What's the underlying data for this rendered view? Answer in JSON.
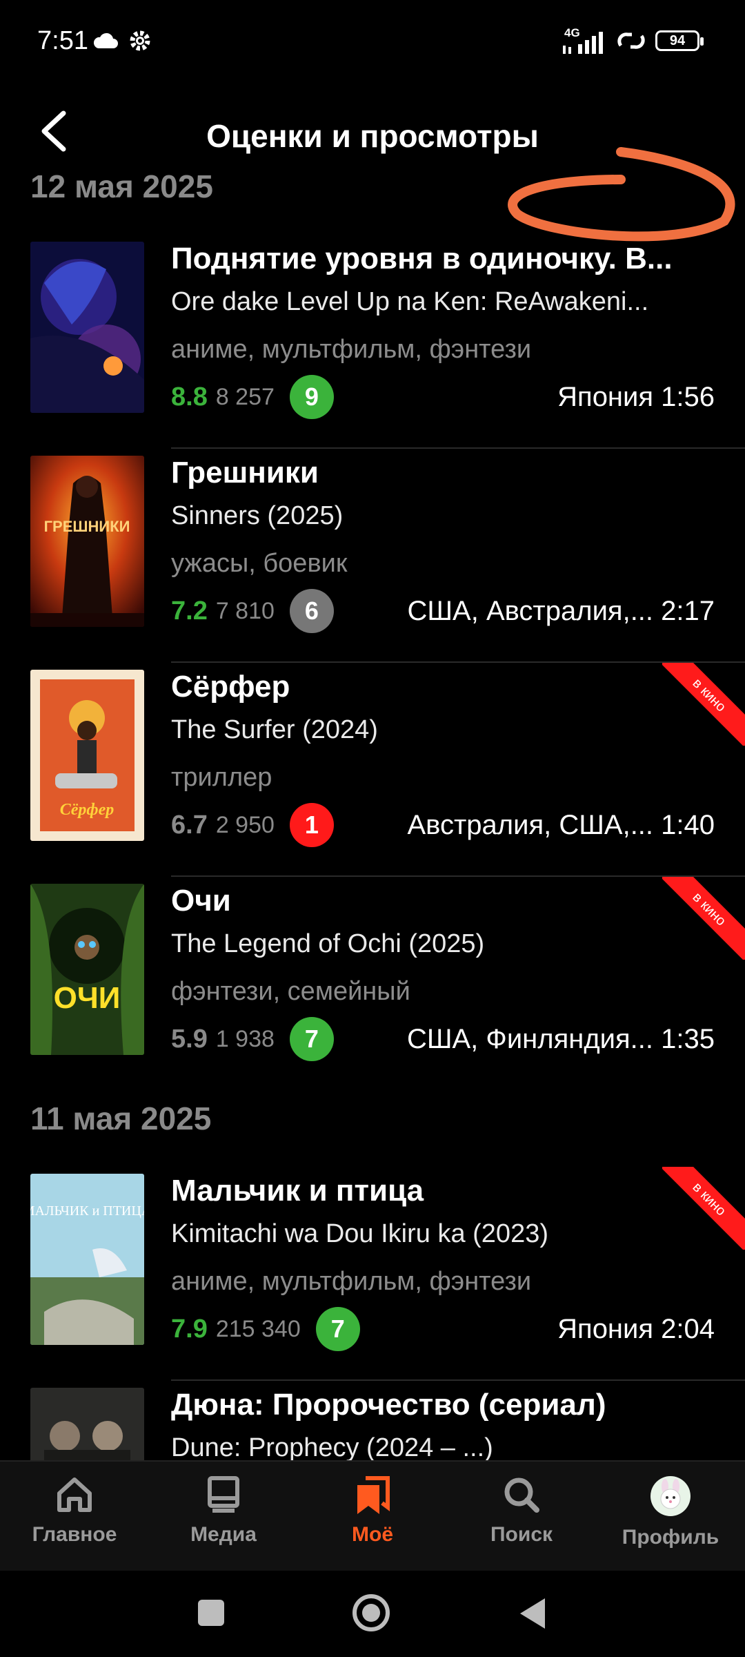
{
  "status_bar": {
    "time": "7:51",
    "network": "4G",
    "battery": "94"
  },
  "header": {
    "title": "Оценки и просмотры"
  },
  "sections": [
    {
      "date": "12 мая 2025",
      "items": [
        {
          "title": "Поднятие уровня в одиночку. В...",
          "original": "Ore dake Level Up na Ken: ReAwakeni...",
          "genres": "аниме, мультфильм, фэнтези",
          "rating": "8.8",
          "rating_color": "#3bb33b",
          "votes": "8 257",
          "user_score": "9",
          "user_score_color": "#3bb33b",
          "country_time": "Япония 1:56",
          "in_cinema": false
        },
        {
          "title": "Грешники",
          "original": "Sinners (2025)",
          "genres": "ужасы, боевик",
          "rating": "7.2",
          "rating_color": "#3bb33b",
          "votes": "7 810",
          "user_score": "6",
          "user_score_color": "#777777",
          "country_time": "США, Австралия,... 2:17",
          "in_cinema": false
        },
        {
          "title": "Сёрфер",
          "original": "The Surfer (2024)",
          "genres": "триллер",
          "rating": "6.7",
          "rating_color": "#8a8a8a",
          "votes": "2 950",
          "user_score": "1",
          "user_score_color": "#ff1a1a",
          "country_time": "Австралия, США,... 1:40",
          "in_cinema": true,
          "cinema_label": "в кино"
        },
        {
          "title": "Очи",
          "original": "The Legend of Ochi (2025)",
          "genres": "фэнтези, семейный",
          "rating": "5.9",
          "rating_color": "#8a8a8a",
          "votes": "1 938",
          "user_score": "7",
          "user_score_color": "#3bb33b",
          "country_time": "США, Финляндия... 1:35",
          "in_cinema": true,
          "cinema_label": "в кино"
        }
      ]
    },
    {
      "date": "11 мая 2025",
      "items": [
        {
          "title": "Мальчик и птица",
          "original": "Kimitachi wa Dou Ikiru ka (2023)",
          "genres": "аниме, мультфильм, фэнтези",
          "rating": "7.9",
          "rating_color": "#3bb33b",
          "votes": "215 340",
          "user_score": "7",
          "user_score_color": "#3bb33b",
          "country_time": "Япония 2:04",
          "in_cinema": true,
          "cinema_label": "в кино"
        },
        {
          "title": "Дюна: Пророчество (сериал)",
          "original": "Dune: Prophecy (2024 – ...)"
        }
      ]
    }
  ],
  "poster_text": {
    "sinners": "ГРЕШНИКИ",
    "surfer": "Сёрфер",
    "ochi": "ОЧИ",
    "boy_bird": "МАЛЬЧИК и ПТИЦА"
  },
  "bottom_nav": [
    {
      "label": "Главное",
      "icon": "home-icon"
    },
    {
      "label": "Медиа",
      "icon": "media-icon"
    },
    {
      "label": "Моё",
      "icon": "bookmarks-icon",
      "active": true
    },
    {
      "label": "Поиск",
      "icon": "search-icon"
    },
    {
      "label": "Профиль",
      "icon": "avatar"
    }
  ],
  "colors": {
    "accent": "#ff5a1f",
    "positive": "#3bb33b",
    "negative": "#ff1a1a",
    "neutral": "#777777",
    "annotation": "#f07040"
  }
}
